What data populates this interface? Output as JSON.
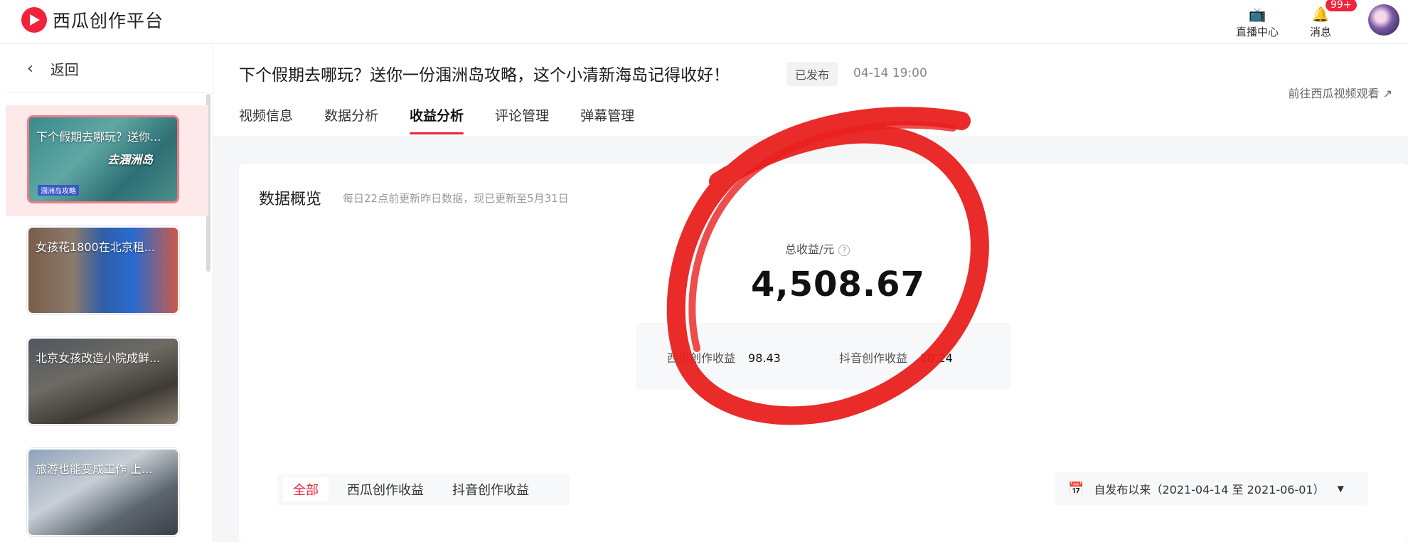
{
  "topbar": {
    "brand": "西瓜创作平台",
    "live_center_label": "直播中心",
    "messages_label": "消息",
    "messages_badge": "99+",
    "live_icon": "tv-icon",
    "bell_icon": "bell-icon"
  },
  "sidebar": {
    "back_label": "返回",
    "videos": [
      {
        "title": "下个假期去哪玩？送你...",
        "overlay_text": "去涠洲岛",
        "tag": "涠洲岛攻略",
        "active": true
      },
      {
        "title": "女孩花1800在北京租...",
        "active": false
      },
      {
        "title": "北京女孩改造小院成鲜...",
        "active": false
      },
      {
        "title": "旅游也能变成工作 上...",
        "active": false
      }
    ]
  },
  "header": {
    "video_title": "下个假期去哪玩？送你一份涠洲岛攻略，这个小清新海岛记得收好！",
    "status": "已发布",
    "publish_time": "04-14 19:00",
    "goto_link": "前往西瓜视频观看",
    "tabs": [
      {
        "label": "视频信息",
        "active": false
      },
      {
        "label": "数据分析",
        "active": false
      },
      {
        "label": "收益分析",
        "active": true
      },
      {
        "label": "评论管理",
        "active": false
      },
      {
        "label": "弹幕管理",
        "active": false
      }
    ]
  },
  "overview": {
    "title": "数据概览",
    "subtitle": "每日22点前更新昨日数据，现已更新至5月31日",
    "total_label": "总收益/元",
    "total_value": "4,508.67",
    "breakdown": [
      {
        "label": "西瓜创作收益",
        "value": "98.43"
      },
      {
        "label": "抖音创作收益",
        "value": "10.24"
      }
    ]
  },
  "filters": {
    "tabs": [
      {
        "label": "全部",
        "active": true
      },
      {
        "label": "西瓜创作收益",
        "active": false
      },
      {
        "label": "抖音创作收益",
        "active": false
      }
    ],
    "date_range": "自发布以来（2021-04-14 至 2021-06-01）"
  },
  "colors": {
    "accent": "#f0233b",
    "annotation": "#e8201f"
  }
}
